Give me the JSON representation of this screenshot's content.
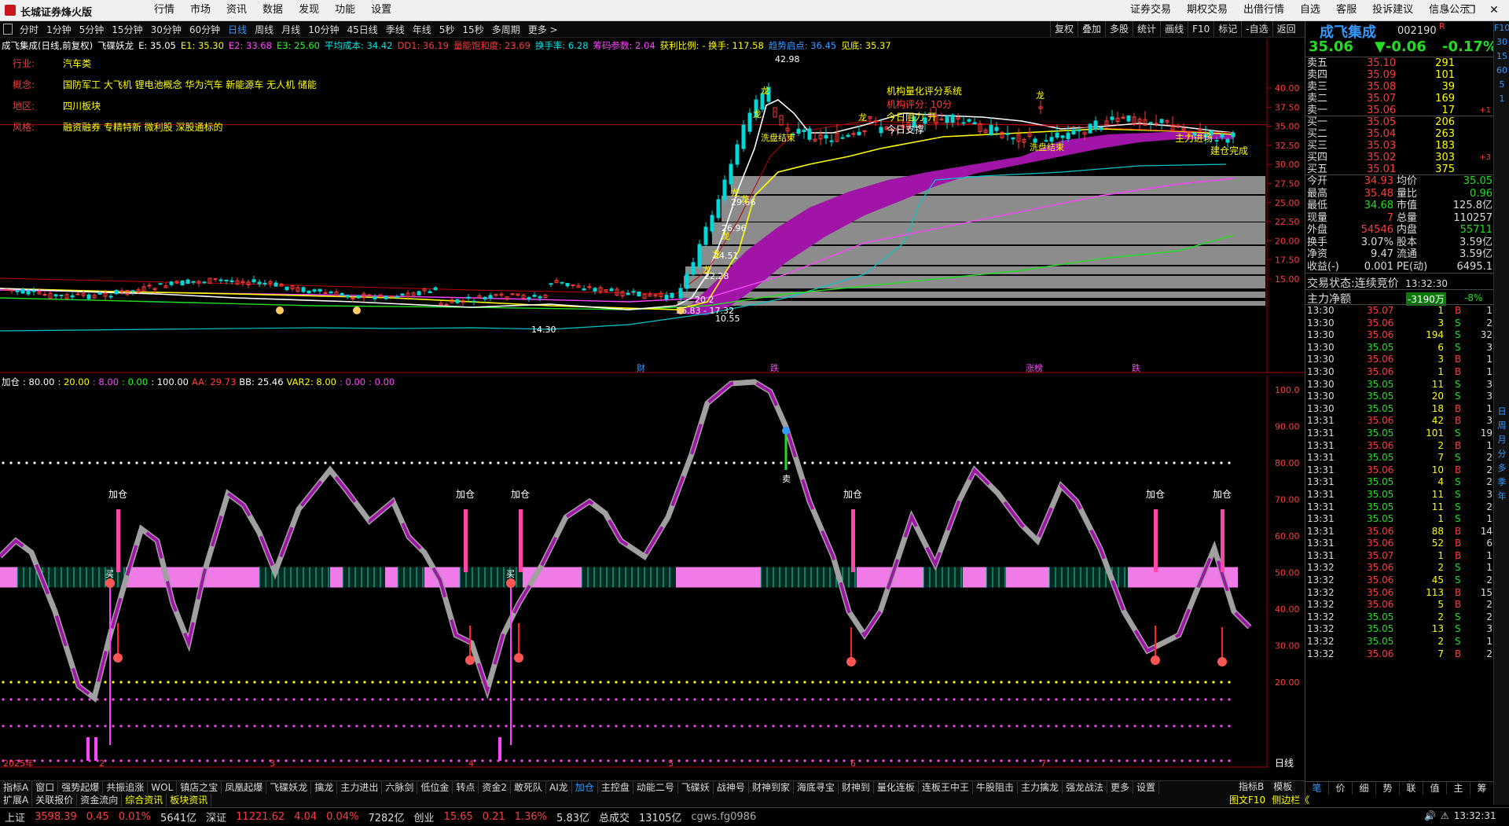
{
  "app": {
    "title": "长城证券烽火版",
    "menu": [
      "行情",
      "市场",
      "资讯",
      "数据",
      "发现",
      "功能",
      "设置"
    ],
    "right_menu": [
      "证券交易",
      "期权交易",
      "出借行情",
      "自选",
      "客服",
      "投诉建议",
      "信息公示"
    ]
  },
  "periods": [
    "分时",
    "1分钟",
    "5分钟",
    "15分钟",
    "30分钟",
    "60分钟",
    "日线",
    "周线",
    "月线",
    "10分钟",
    "45日线",
    "季线",
    "年线",
    "5秒",
    "15秒",
    "多周期",
    "更多 >"
  ],
  "period_active": "日线",
  "toolbar_right": [
    "复权",
    "叠加",
    "多股",
    "统计",
    "画线",
    "F10",
    "标记",
    "-自选",
    "返回"
  ],
  "main_legend": [
    {
      "t": "成飞集成(日线,前复权)",
      "c": "#ffffff"
    },
    {
      "t": "飞碟妖龙",
      "c": "#ffffff"
    },
    {
      "t": "E: 35.05",
      "c": "#ffffff"
    },
    {
      "t": "E1: 35.30",
      "c": "#ffff00"
    },
    {
      "t": "E2: 33.68",
      "c": "#ff44ff"
    },
    {
      "t": "E3: 25.60",
      "c": "#22ff22"
    },
    {
      "t": "平均成本: 34.42",
      "c": "#00e5e5"
    },
    {
      "t": "DD1: 36.19",
      "c": "#ff3b3b"
    },
    {
      "t": "量能饱和度: 23.69",
      "c": "#ff3b3b"
    },
    {
      "t": "换手率: 6.28",
      "c": "#00e5e5"
    },
    {
      "t": "筹码参数: 2.04",
      "c": "#ff44ff"
    },
    {
      "t": "获利比例: - 换手: 117.58",
      "c": "#ffff00"
    },
    {
      "t": "趋势启点: 36.45",
      "c": "#3399ff"
    },
    {
      "t": "见底: 35.37",
      "c": "#ffff00"
    }
  ],
  "info": [
    {
      "k": "行业:",
      "v": "汽车类"
    },
    {
      "k": "概念:",
      "v": "国防军工 大飞机 锂电池概念 华为汽车 新能源车 无人机 储能"
    },
    {
      "k": "地区:",
      "v": "四川板块"
    },
    {
      "k": "风格:",
      "v": "融资融券 专精特新 微利股 深股通标的"
    }
  ],
  "main_axis": [
    "40.00",
    "37.50",
    "35.00",
    "32.50",
    "30.00",
    "27.50",
    "25.00",
    "22.50",
    "20.00",
    "17.50",
    "15.00"
  ],
  "main_annotations": {
    "high": "42.98",
    "low": "14.30",
    "low2": "16.83 - 17.32",
    "a1": "29.66",
    "a2": "26.96",
    "a3": "24.51",
    "a4": "22.28",
    "a5": "20.2",
    "a6": "10.55",
    "sys": "机构量化评分系统",
    "score": "机构评分: 10分",
    "resist": "今日阻力 开 ",
    "support": "今日支撑",
    "wash": "洗盘结束",
    "wash2": "洗盘结束",
    "bull": "主力进场",
    "build": "建仓完成",
    "flag1": "财",
    "flag2": "跌",
    "flag3": "涨榜",
    "flag4": "跌"
  },
  "ind_legend": [
    {
      "t": "加仓",
      "c": "#ffffff"
    },
    {
      "t": ": 80.00",
      "c": "#ffffff"
    },
    {
      "t": ": 20.00",
      "c": "#ffff00"
    },
    {
      "t": ": 8.00",
      "c": "#ff44ff"
    },
    {
      "t": ": 0.00",
      "c": "#22ff22"
    },
    {
      "t": ": 100.00",
      "c": "#ffffff"
    },
    {
      "t": "AA: 29.73",
      "c": "#ff3b3b"
    },
    {
      "t": "BB: 25.46",
      "c": "#ffffff"
    },
    {
      "t": "VAR2: 8.00",
      "c": "#ffff00"
    },
    {
      "t": ": 0.00",
      "c": "#ff44ff"
    },
    {
      "t": ": 0.00",
      "c": "#ff44ff"
    }
  ],
  "ind_axis": [
    "100.0",
    "90.00",
    "80.00",
    "70.00",
    "60.00",
    "50.00",
    "40.00",
    "30.00",
    "20.00"
  ],
  "ind_labels": {
    "add": "加仓",
    "buy": "买",
    "sell": "卖"
  },
  "x_dates": [
    "2025年",
    "2",
    "3",
    "4",
    "5",
    "6",
    "7"
  ],
  "x_corner": "日线",
  "stock": {
    "name": "成飞集成",
    "code": "002190",
    "mark": "R",
    "price": "35.06",
    "change": "▼-0.06",
    "pct": "-0.17%"
  },
  "sell_orders": [
    {
      "l": "卖五",
      "p": "35.10",
      "v": "291",
      "d": ""
    },
    {
      "l": "卖四",
      "p": "35.09",
      "v": "101",
      "d": ""
    },
    {
      "l": "卖三",
      "p": "35.08",
      "v": "39",
      "d": ""
    },
    {
      "l": "卖二",
      "p": "35.07",
      "v": "169",
      "d": ""
    },
    {
      "l": "卖一",
      "p": "35.06",
      "v": "17",
      "d": "+1"
    }
  ],
  "buy_orders": [
    {
      "l": "买一",
      "p": "35.05",
      "v": "206",
      "d": ""
    },
    {
      "l": "买二",
      "p": "35.04",
      "v": "263",
      "d": ""
    },
    {
      "l": "买三",
      "p": "35.03",
      "v": "183",
      "d": ""
    },
    {
      "l": "买四",
      "p": "35.02",
      "v": "303",
      "d": "+3"
    },
    {
      "l": "买五",
      "p": "35.01",
      "v": "375",
      "d": ""
    }
  ],
  "quote": [
    {
      "a": "今开",
      "av": "34.93",
      "ac": "#ff3b3b",
      "b": "均价",
      "bv": "35.05",
      "bc": "#22dd22"
    },
    {
      "a": "最高",
      "av": "35.48",
      "ac": "#ff3b3b",
      "b": "量比",
      "bv": "0.96",
      "bc": "#22dd22"
    },
    {
      "a": "最低",
      "av": "34.68",
      "ac": "#22dd22",
      "b": "市值",
      "bv": "125.8亿",
      "bc": "#ddd"
    },
    {
      "a": "现量",
      "av": "7",
      "ac": "#ff3b3b",
      "b": "总量",
      "bv": "110257",
      "bc": "#ddd"
    },
    {
      "a": "外盘",
      "av": "54546",
      "ac": "#ff3b3b",
      "b": "内盘",
      "bv": "55711",
      "bc": "#22dd22"
    },
    {
      "a": "换手",
      "av": "3.07%",
      "ac": "#ddd",
      "b": "股本",
      "bv": "3.59亿",
      "bc": "#ddd"
    },
    {
      "a": "净资",
      "av": "9.47",
      "ac": "#ddd",
      "b": "流通",
      "bv": "3.59亿",
      "bc": "#ddd"
    },
    {
      "a": "收益(-)",
      "av": "0.001",
      "ac": "#ddd",
      "b": "PE(动)",
      "bv": "6495.1",
      "bc": "#ddd"
    }
  ],
  "trade_state": {
    "label": "交易状态:",
    "value": "连续竞价",
    "time": "13:32:30"
  },
  "net_flow": {
    "label": "主力净额",
    "value": "-3190万",
    "pct": "-8%"
  },
  "ticks": [
    [
      "13:30",
      "35.07",
      "1",
      "B",
      "1"
    ],
    [
      "13:30",
      "35.06",
      "3",
      "S",
      "2"
    ],
    [
      "13:30",
      "35.06",
      "194",
      "S",
      "32"
    ],
    [
      "13:30",
      "35.05",
      "6",
      "S",
      "3"
    ],
    [
      "13:30",
      "35.06",
      "3",
      "B",
      "1"
    ],
    [
      "13:30",
      "35.06",
      "1",
      "B",
      "1"
    ],
    [
      "13:30",
      "35.05",
      "11",
      "S",
      "3"
    ],
    [
      "13:30",
      "35.05",
      "20",
      "S",
      "3"
    ],
    [
      "13:30",
      "35.05",
      "18",
      "B",
      "1"
    ],
    [
      "13:31",
      "35.06",
      "42",
      "B",
      "3"
    ],
    [
      "13:31",
      "35.05",
      "101",
      "S",
      "19"
    ],
    [
      "13:31",
      "35.06",
      "2",
      "B",
      "1"
    ],
    [
      "13:31",
      "35.05",
      "7",
      "S",
      "2"
    ],
    [
      "13:31",
      "35.06",
      "10",
      "B",
      "2"
    ],
    [
      "13:31",
      "35.05",
      "4",
      "S",
      "2"
    ],
    [
      "13:31",
      "35.05",
      "11",
      "S",
      "3"
    ],
    [
      "13:31",
      "35.05",
      "11",
      "S",
      "2"
    ],
    [
      "13:31",
      "35.05",
      "1",
      "S",
      "1"
    ],
    [
      "13:31",
      "35.06",
      "88",
      "B",
      "14"
    ],
    [
      "13:31",
      "35.06",
      "52",
      "B",
      "6"
    ],
    [
      "13:31",
      "35.07",
      "1",
      "B",
      "1"
    ],
    [
      "13:32",
      "35.06",
      "2",
      "S",
      "1"
    ],
    [
      "13:32",
      "35.06",
      "45",
      "S",
      "2"
    ],
    [
      "13:32",
      "35.06",
      "113",
      "B",
      "15"
    ],
    [
      "13:32",
      "35.06",
      "5",
      "B",
      "2"
    ],
    [
      "13:32",
      "35.05",
      "2",
      "S",
      "2"
    ],
    [
      "13:32",
      "35.05",
      "13",
      "S",
      "3"
    ],
    [
      "13:32",
      "35.05",
      "2",
      "S",
      "1"
    ],
    [
      "13:32",
      "35.06",
      "7",
      "B",
      "2"
    ]
  ],
  "rside": [
    "日",
    "周",
    "月",
    "分",
    "多",
    "季",
    "年"
  ],
  "rside_top": [
    "F10",
    "30",
    "15",
    "60",
    "5",
    "1"
  ],
  "tabs1": [
    "指标A",
    "窗口",
    "强势起爆",
    "共振追涨",
    "WOL",
    "镇店之宝",
    "凤凰起爆",
    "飞碟妖龙",
    "擒龙",
    "主力进出",
    "六脉剑",
    "低位金",
    "转点",
    "资金2",
    "敢死队",
    "AI龙",
    "加仓",
    "主控盘",
    "动能二号",
    "飞碟妖",
    "战神号",
    "财神到家",
    "海底寻宝",
    "财神到",
    "量化连板",
    "连板王中王",
    "牛股阻击",
    "主力擒龙",
    "强龙战法",
    "更多",
    "设置"
  ],
  "tabs1_right": [
    "指标B",
    "模板"
  ],
  "tabs2": [
    "扩展A",
    "关联报价",
    "资金流向",
    "综合资讯",
    "板块资讯"
  ],
  "tabs2_right": [
    "图文F10",
    "侧边栏《"
  ],
  "rtabs": [
    "笔",
    "价",
    "细",
    "势",
    "联",
    "值",
    "主",
    "筹"
  ],
  "status": [
    {
      "t": "上证",
      "c": "#ddd"
    },
    {
      "t": "3598.39",
      "c": "#ff3b3b"
    },
    {
      "t": "0.45",
      "c": "#ff3b3b"
    },
    {
      "t": "0.01%",
      "c": "#ff3b3b"
    },
    {
      "t": "5641亿",
      "c": "#ddd"
    },
    {
      "t": "深证",
      "c": "#ddd"
    },
    {
      "t": "11221.62",
      "c": "#ff3b3b"
    },
    {
      "t": "4.04",
      "c": "#ff3b3b"
    },
    {
      "t": "0.04%",
      "c": "#ff3b3b"
    },
    {
      "t": "7282亿",
      "c": "#ddd"
    },
    {
      "t": "创业",
      "c": "#ddd"
    },
    {
      "t": "15.65",
      "c": "#ff3b3b"
    },
    {
      "t": "0.21",
      "c": "#ff3b3b"
    },
    {
      "t": "1.36%",
      "c": "#ff3b3b"
    },
    {
      "t": "5.83亿",
      "c": "#ddd"
    },
    {
      "t": "总成交",
      "c": "#ddd"
    },
    {
      "t": "13105亿",
      "c": "#ddd"
    },
    {
      "t": "cgws.fg0986",
      "c": "#aaa"
    }
  ],
  "clock": "13:32:31"
}
